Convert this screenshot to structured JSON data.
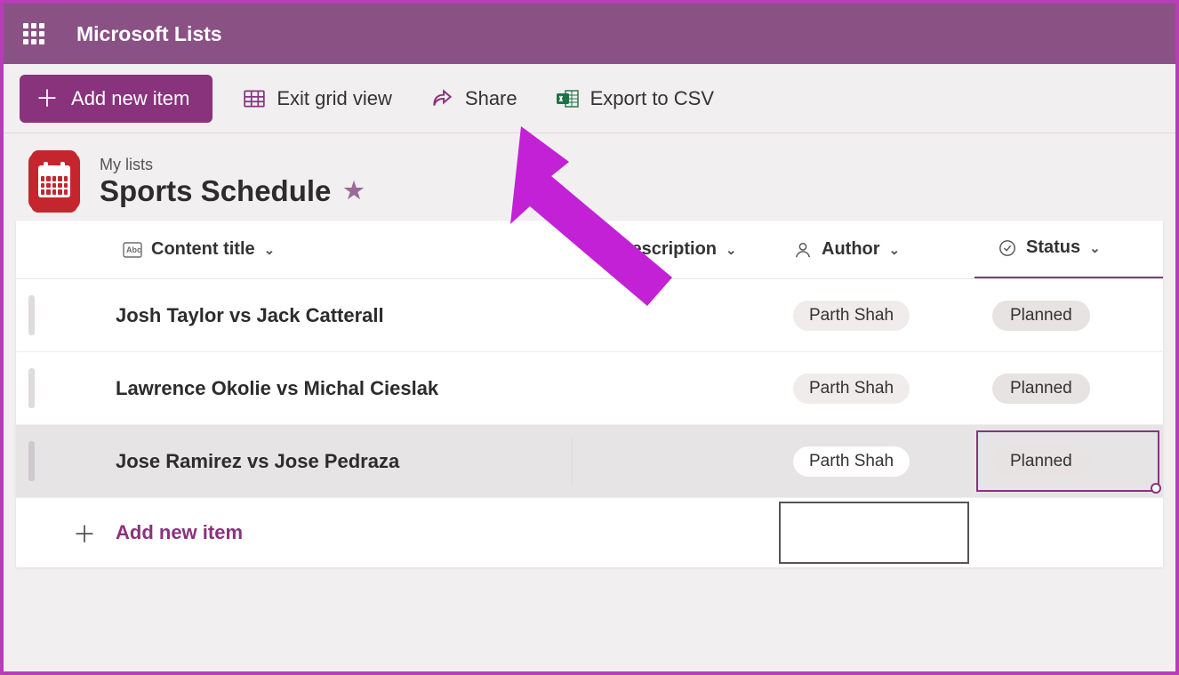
{
  "header": {
    "app_name": "Microsoft Lists"
  },
  "toolbar": {
    "add_label": "Add new item",
    "exit_grid": "Exit grid view",
    "share": "Share",
    "export": "Export to CSV"
  },
  "list": {
    "crumb": "My lists",
    "title": "Sports Schedule"
  },
  "columns": {
    "title": "Content title",
    "description": "Description",
    "author": "Author",
    "status": "Status"
  },
  "rows": [
    {
      "title": "Josh Taylor vs Jack Catterall",
      "author": "Parth Shah",
      "status": "Planned",
      "selected": false
    },
    {
      "title": "Lawrence Okolie vs Michal Cieslak",
      "author": "Parth Shah",
      "status": "Planned",
      "selected": false
    },
    {
      "title": "Jose Ramirez vs Jose Pedraza",
      "author": "Parth Shah",
      "status": "Planned",
      "selected": true
    }
  ],
  "add_row_label": "Add new item"
}
